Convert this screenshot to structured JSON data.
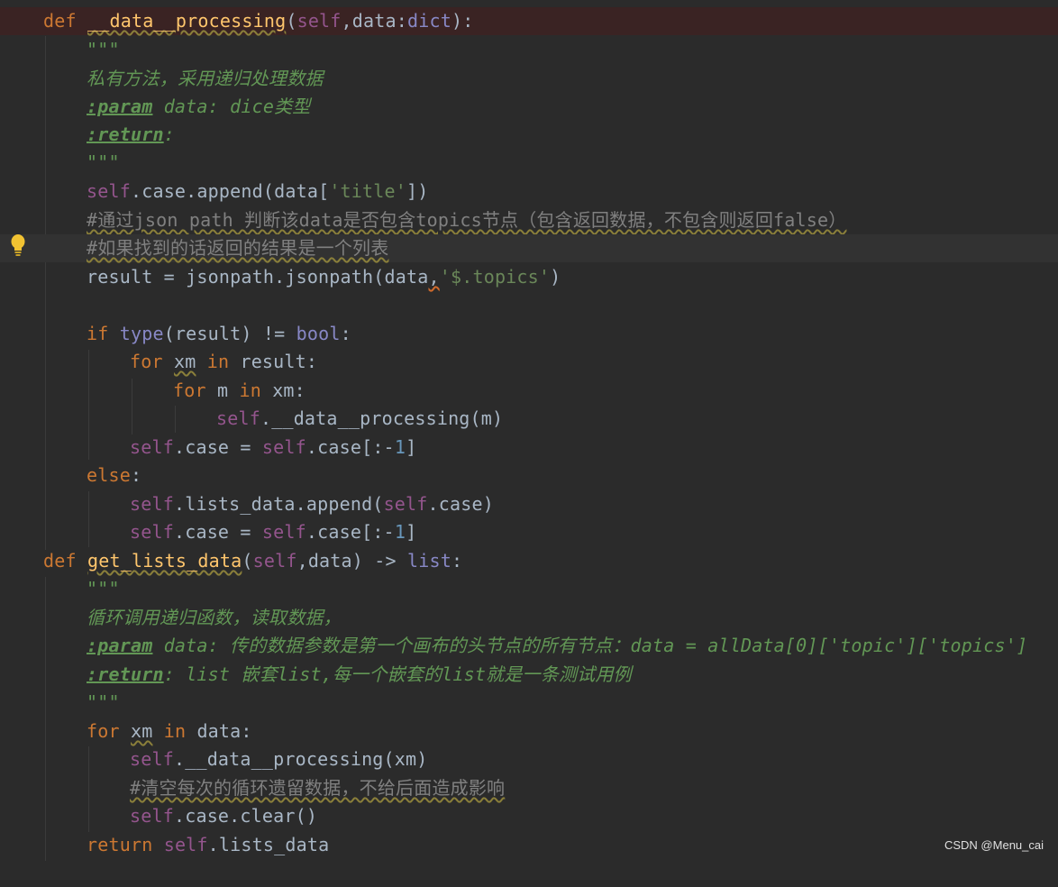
{
  "lines": {
    "l1": {
      "def": "def",
      "name": "__data__processing",
      "p1": "(",
      "self": "self",
      "p2": ",data:",
      "t": "dict",
      "p3": "):"
    },
    "l2": {
      "q": "\"\"\""
    },
    "l3": {
      "doc": "私有方法，采用递归处理数据"
    },
    "l4": {
      "tag": ":param",
      "rest": " data: dice类型"
    },
    "l5": {
      "tag": ":return",
      "rest": ":"
    },
    "l6": {
      "q": "\"\"\""
    },
    "l7": {
      "self": "self",
      "a": ".case.append(data[",
      "s": "'title'",
      "b": "])"
    },
    "l8": {
      "c": "#通过json path 判断该data是否包含topics节点（包含返回数据，不包含则返回false）"
    },
    "l9": {
      "c": "#如果找到的话返回的结果是一个列表"
    },
    "l10": {
      "a": "result = jsonpath.jsonpath(data",
      "comma": ",",
      "s": "'$.topics'",
      "b": ")"
    },
    "l12": {
      "kw": "if",
      "sp": " ",
      "bi": "type",
      "a": "(result) != ",
      "bi2": "bool",
      "b": ":"
    },
    "l13": {
      "kw": "for",
      "v": "xm",
      "kw2": "in",
      "a": "result:"
    },
    "l14": {
      "kw": "for",
      "a": " m ",
      "kw2": "in",
      "b": " xm:"
    },
    "l15": {
      "self": "self",
      "a": ".__data__processing(m)"
    },
    "l16": {
      "self": "self",
      "a": ".case = ",
      "self2": "self",
      "b": ".case[:-",
      "n": "1",
      "c": "]"
    },
    "l17": {
      "kw": "else",
      "b": ":"
    },
    "l18": {
      "self": "self",
      "a": ".lists_data.append(",
      "self2": "self",
      "b": ".case)"
    },
    "l19": {
      "self": "self",
      "a": ".case = ",
      "self2": "self",
      "b": ".case[:-",
      "n": "1",
      "c": "]"
    },
    "l20": {
      "def": "def",
      "name": "get_lists_data",
      "p1": "(",
      "self": "self",
      "p2": ",data) -> ",
      "t": "list",
      "p3": ":"
    },
    "l21": {
      "q": "\"\"\""
    },
    "l22": {
      "doc": "循环调用递归函数，读取数据，"
    },
    "l23": {
      "tag": ":param",
      "rest": " data: 传的数据参数是第一个画布的头节点的所有节点：data = allData[0]['topic']['topics']"
    },
    "l24": {
      "tag": ":return",
      "rest": ": list 嵌套list,每一个嵌套的list就是一条测试用例"
    },
    "l25": {
      "q": "\"\"\""
    },
    "l26": {
      "kw": "for",
      "v": "xm",
      "kw2": "in",
      "a": " data:"
    },
    "l27": {
      "self": "self",
      "a": ".__data__processing(xm)"
    },
    "l28": {
      "c": "#清空每次的循环遗留数据，不给后面造成影响"
    },
    "l29": {
      "self": "self",
      "a": ".case.clear()"
    },
    "l30": {
      "kw": "return",
      "sp": " ",
      "self": "self",
      "a": ".lists_data"
    }
  },
  "watermark": "CSDN @Menu_cai",
  "colors": {
    "background": "#2b2b2b",
    "keyword": "#cc7832",
    "function": "#ffc66d",
    "self": "#94558d",
    "string": "#6a8759",
    "comment": "#808080",
    "docstring": "#629755"
  }
}
